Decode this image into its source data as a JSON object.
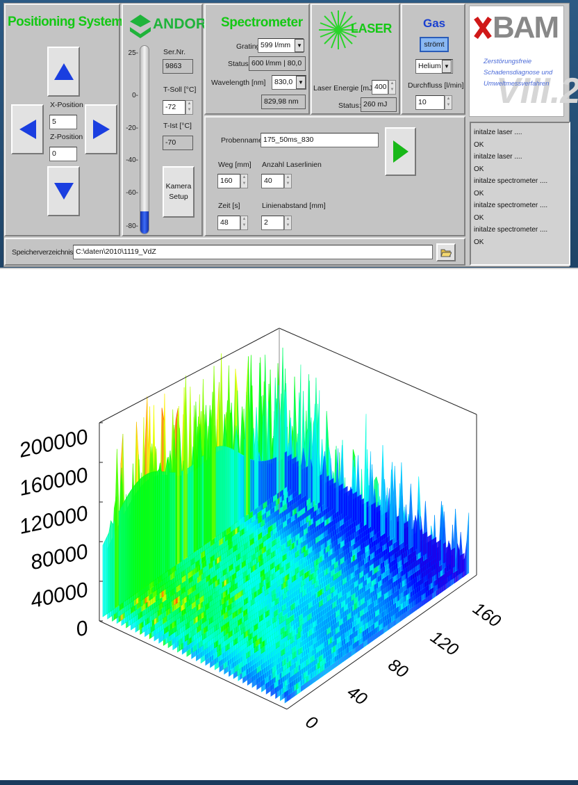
{
  "positioning": {
    "title": "Positioning System",
    "x_label": "X-Position",
    "x_value": "5",
    "z_label": "Z-Position",
    "z_value": "0"
  },
  "andor": {
    "logo_text": "ANDOR",
    "scale_ticks": [
      "25",
      "0",
      "-20",
      "-40",
      "-60",
      "-80"
    ],
    "serial_label": "Ser.Nr.",
    "serial_value": "9863",
    "t_soll_label": "T-Soll [°C]",
    "t_soll_value": "-72",
    "t_ist_label": "T-Ist [°C]",
    "t_ist_value": "-70",
    "camera_button": "Kamera Setup",
    "thermometer_level": 0.12
  },
  "spectrometer": {
    "title": "Spectrometer",
    "grating_label": "Grating",
    "grating_value": "599 l/mm",
    "status_label": "Status:",
    "status_value": "600 l/mm | 80,0",
    "wavelength_label": "Wavelength [nm]",
    "wavelength_value": "830,0",
    "wavelength_readout": "829,98 nm"
  },
  "laser": {
    "title": "LASER",
    "energy_label": "Laser Energie [mJ]",
    "energy_value": "400",
    "status_label": "Status:",
    "status_value": "260 mJ"
  },
  "gas": {
    "title": "Gas",
    "flow_button": "strömt",
    "gas_type": "Helium",
    "flow_label": "Durchfluss [l/min]",
    "flow_value": "10"
  },
  "bam": {
    "logo_text": "BAM",
    "line1": "Zerstörungsfreie",
    "line2": "Schadensdiagnose und",
    "line3": "Umweltmessverfahren",
    "division": "VIII.2"
  },
  "sample": {
    "name_label": "Probenname",
    "name_value": "175_50ms_830",
    "path_label": "Weg [mm]",
    "path_value": "160",
    "lines_label": "Anzahl Laserlinien",
    "lines_value": "40",
    "time_label": "Zeit [s]",
    "time_value": "48",
    "spacing_label": "Linienabstand [mm]",
    "spacing_value": "2"
  },
  "storage": {
    "label": "Speicherverzeichnis",
    "path": "C:\\daten\\2010\\1119_VdZ"
  },
  "log": [
    "initalze laser ....",
    "OK",
    "initalze laser ....",
    "OK",
    "initalze spectrometer ....",
    "OK",
    "initalze spectrometer ....",
    "OK",
    "initalze spectrometer ....",
    "OK"
  ],
  "colors": {
    "title_green": "#14c814",
    "arrow_blue": "#1a3ee0",
    "start_green": "#18b818",
    "andor_green": "#1fb33a"
  },
  "chart_data": {
    "type": "surface",
    "z_ticks": [
      "0",
      "40000",
      "80000",
      "120000",
      "160000",
      "200000"
    ],
    "x_ticks": [
      "0",
      "40",
      "80",
      "120",
      "160"
    ],
    "zlim": [
      0,
      200000
    ],
    "xlim": [
      0,
      160
    ],
    "colormap": "rainbow (violet low → red high)",
    "grid": "on"
  }
}
